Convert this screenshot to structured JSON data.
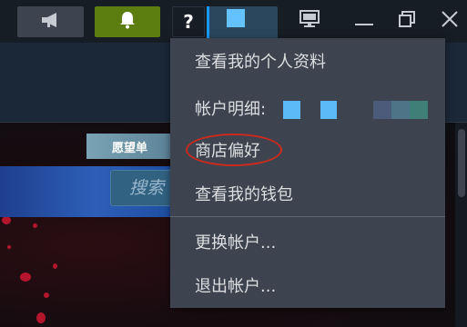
{
  "topbar": {
    "icons": {
      "announce": "megaphone-icon",
      "notify": "bell-icon",
      "help": "?",
      "bigpicture": "monitor-icon",
      "minimize": "minimize-icon",
      "maximize": "maximize-icon",
      "close": "close-icon"
    },
    "colors": {
      "announce_bg": "#3d4450",
      "notify_bg": "#5c7e10",
      "account_bg": "#2a475e",
      "avatar": "#63c2ff"
    }
  },
  "store": {
    "wishlist_label": "愿望单",
    "search_placeholder": "搜索"
  },
  "dropdown": {
    "items": [
      {
        "label": "查看我的个人资料"
      },
      {
        "label": "帐户明细:"
      },
      {
        "label": "商店偏好"
      },
      {
        "label": "查看我的钱包"
      },
      {
        "label": "更换帐户..."
      },
      {
        "label": "退出帐户..."
      }
    ],
    "highlighted_item": "商店偏好",
    "highlight_color": "#cc2a1c"
  }
}
